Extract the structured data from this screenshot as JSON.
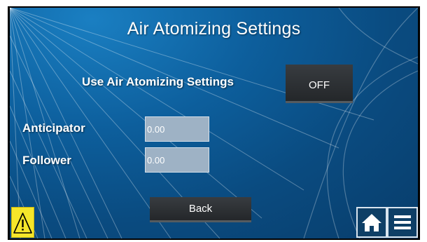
{
  "screen": {
    "title": "Air Atomizing Settings"
  },
  "use_air_atomizing": {
    "label": "Use Air Atomizing Settings",
    "toggle_value": "OFF"
  },
  "anticipator": {
    "label": "Anticipator",
    "value": "0.00"
  },
  "follower": {
    "label": "Follower",
    "value": "0.00"
  },
  "back_button": {
    "label": "Back"
  },
  "icons": {
    "warning": "warning-icon",
    "home": "home-icon",
    "menu": "menu-icon"
  },
  "colors": {
    "background": "#0d5f9d",
    "button": "#2e3236",
    "field": "#9eb2c5",
    "warning": "#f5e62a",
    "nav_button": "#0e3f66"
  }
}
